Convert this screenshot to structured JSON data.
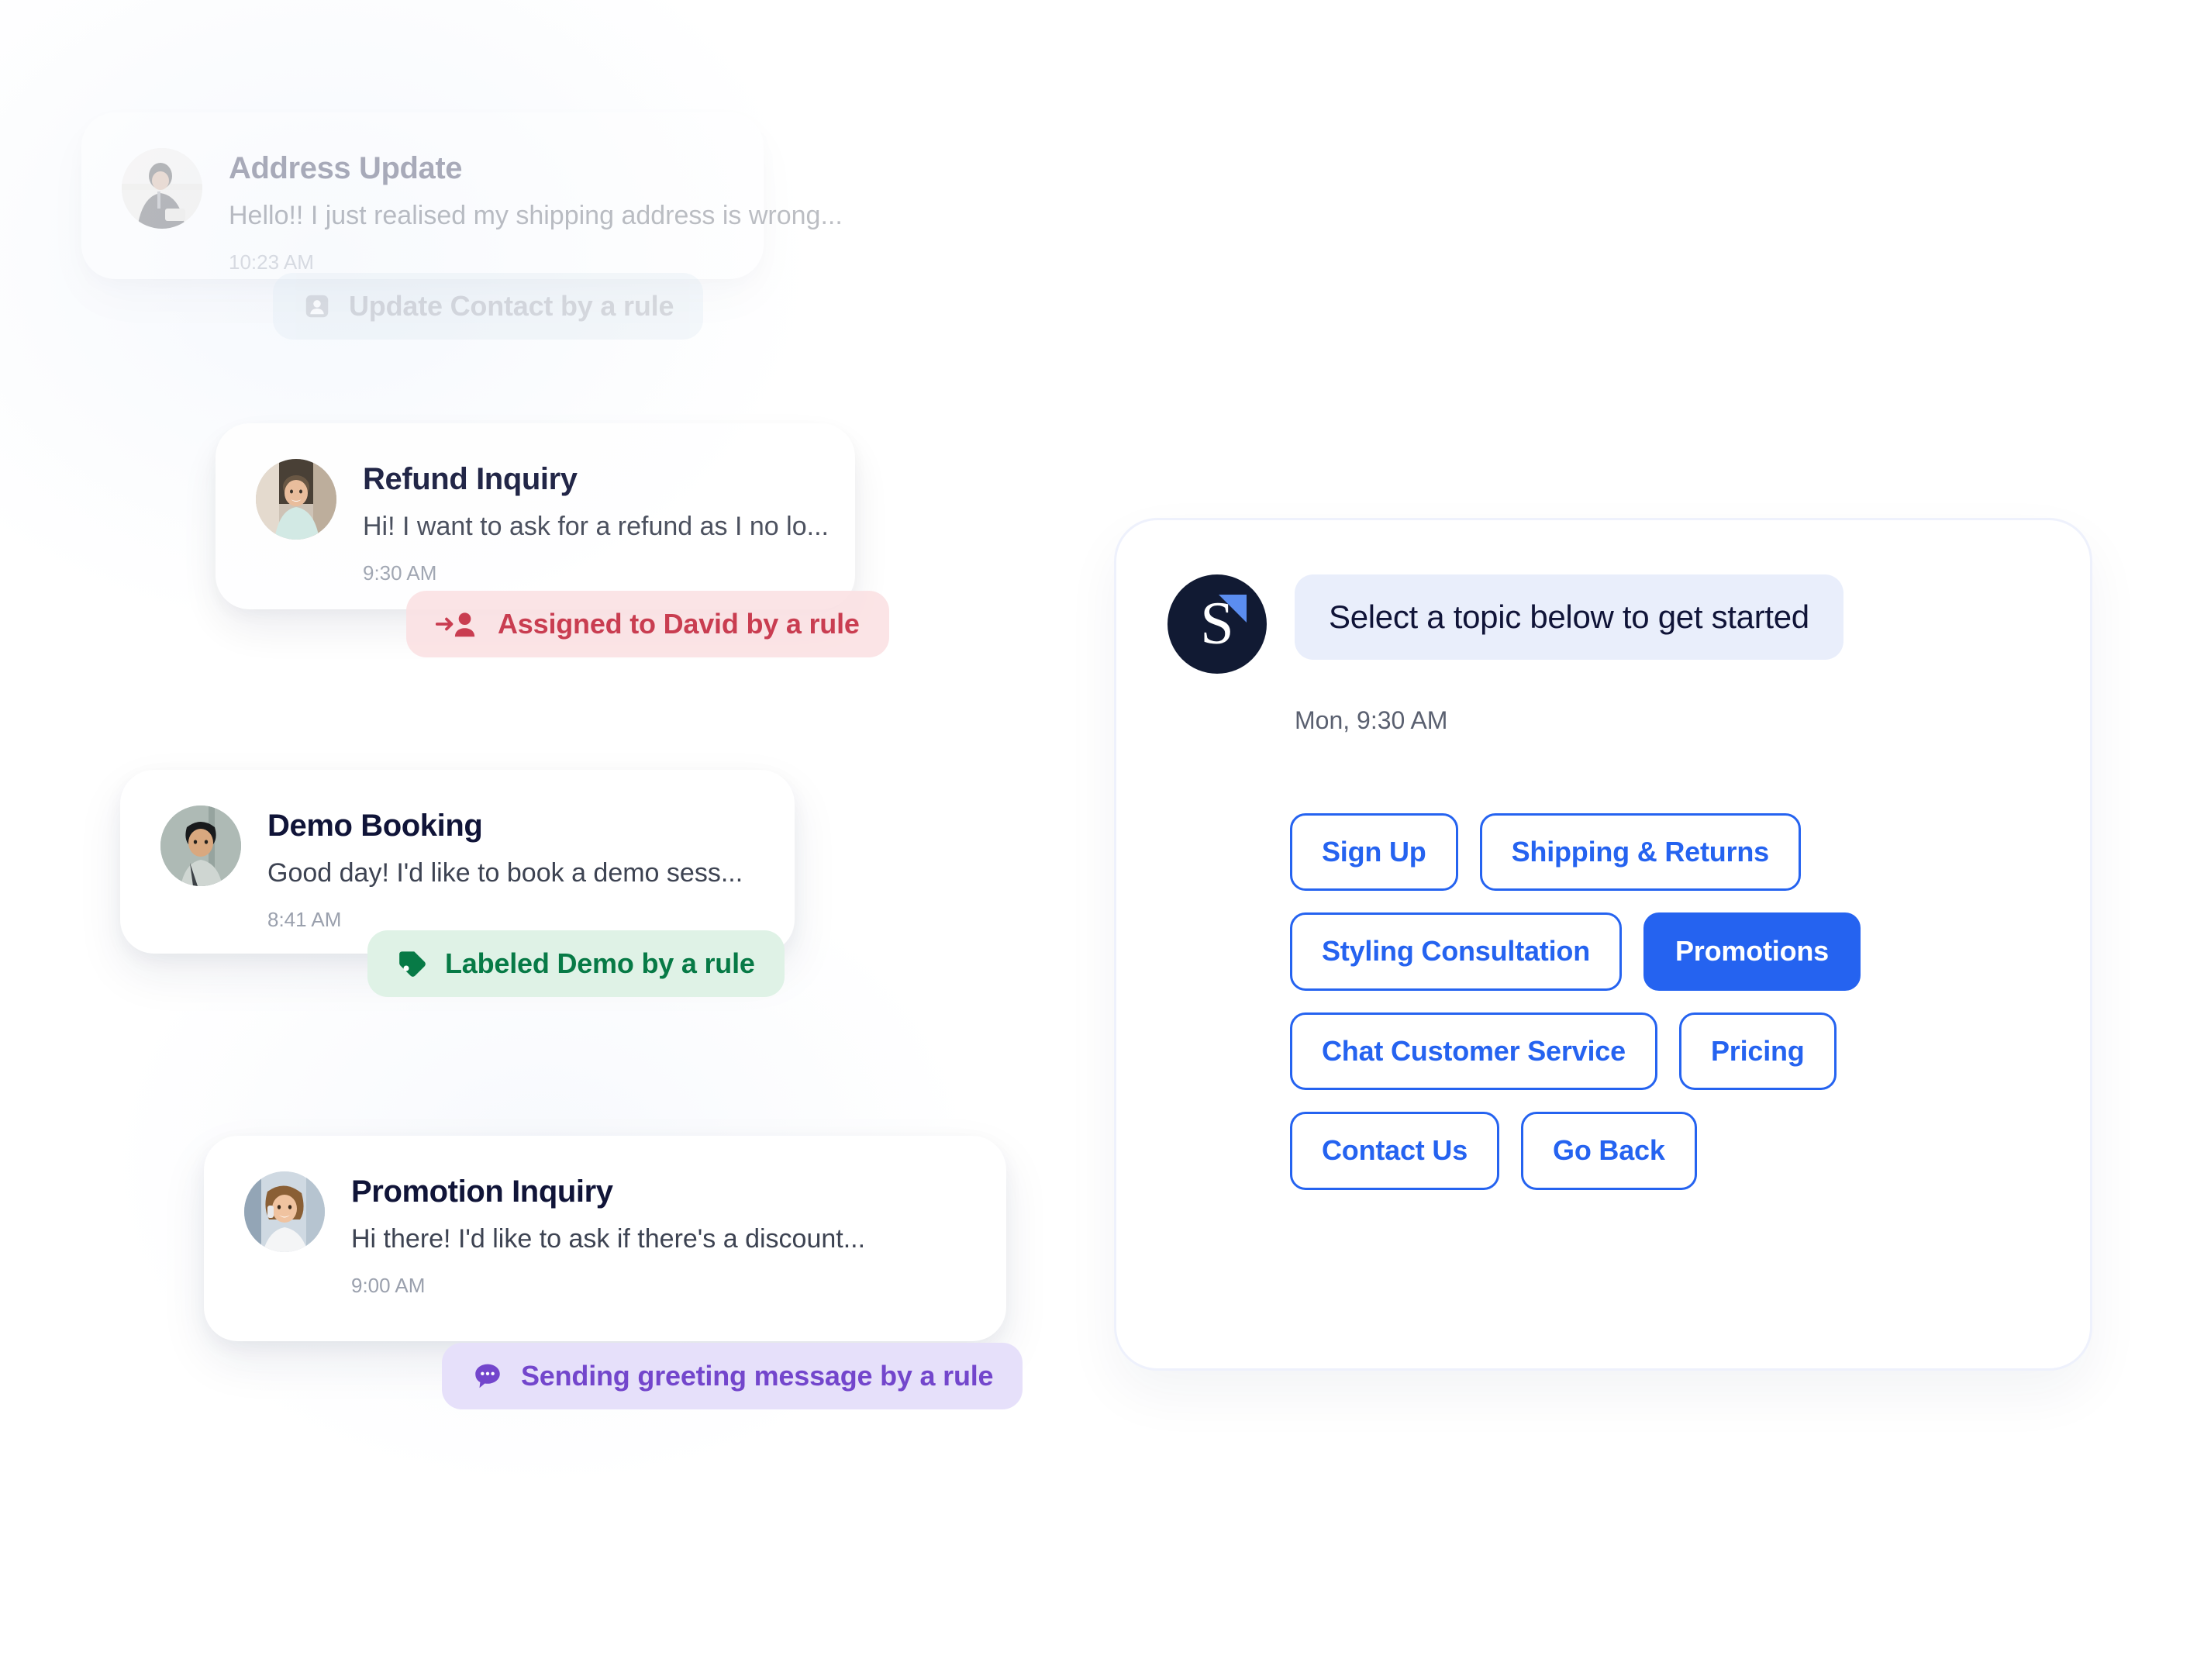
{
  "conversations": [
    {
      "title": "Address Update",
      "preview": "Hello!! I just realised my shipping address is wrong...",
      "time": "10:23 AM",
      "badge": {
        "text": "Update Contact by a rule",
        "icon": "contact-card-icon",
        "color": "#8d93a0",
        "background": "#dfeaf2"
      }
    },
    {
      "title": "Refund Inquiry",
      "preview": "Hi! I want to ask for a refund as I no lo...",
      "time": "9:30 AM",
      "badge": {
        "text": "Assigned to David by a rule",
        "icon": "assign-person-icon",
        "color": "#c62e43",
        "background": "#fbe2e4"
      }
    },
    {
      "title": "Demo Booking",
      "preview": "Good day! I'd like to book a demo sess...",
      "time": "8:41 AM",
      "badge": {
        "text": "Labeled Demo by a rule",
        "icon": "tag-icon",
        "color": "#077a46",
        "background": "#dff2e6"
      }
    },
    {
      "title": "Promotion Inquiry",
      "preview": "Hi there! I'd like to ask if there's a discount...",
      "time": "9:00 AM",
      "badge": {
        "text": "Sending greeting message by a rule",
        "icon": "chat-bubble-dots-icon",
        "color": "#7346cc",
        "background": "#e6e0fa"
      }
    }
  ],
  "widget": {
    "brand_letter": "S",
    "message": "Select a topic below to get started",
    "timestamp": "Mon, 9:30 AM",
    "topics": [
      {
        "label": "Sign Up",
        "selected": false
      },
      {
        "label": "Shipping & Returns",
        "selected": false
      },
      {
        "label": "Styling Consultation",
        "selected": false
      },
      {
        "label": "Promotions",
        "selected": true
      },
      {
        "label": "Chat Customer Service",
        "selected": false
      },
      {
        "label": "Pricing",
        "selected": false
      },
      {
        "label": "Contact Us",
        "selected": false
      },
      {
        "label": "Go Back",
        "selected": false
      }
    ],
    "accent_color": "#2563f0",
    "bubble_color": "#e9eefb",
    "brand_color": "#111a33"
  }
}
